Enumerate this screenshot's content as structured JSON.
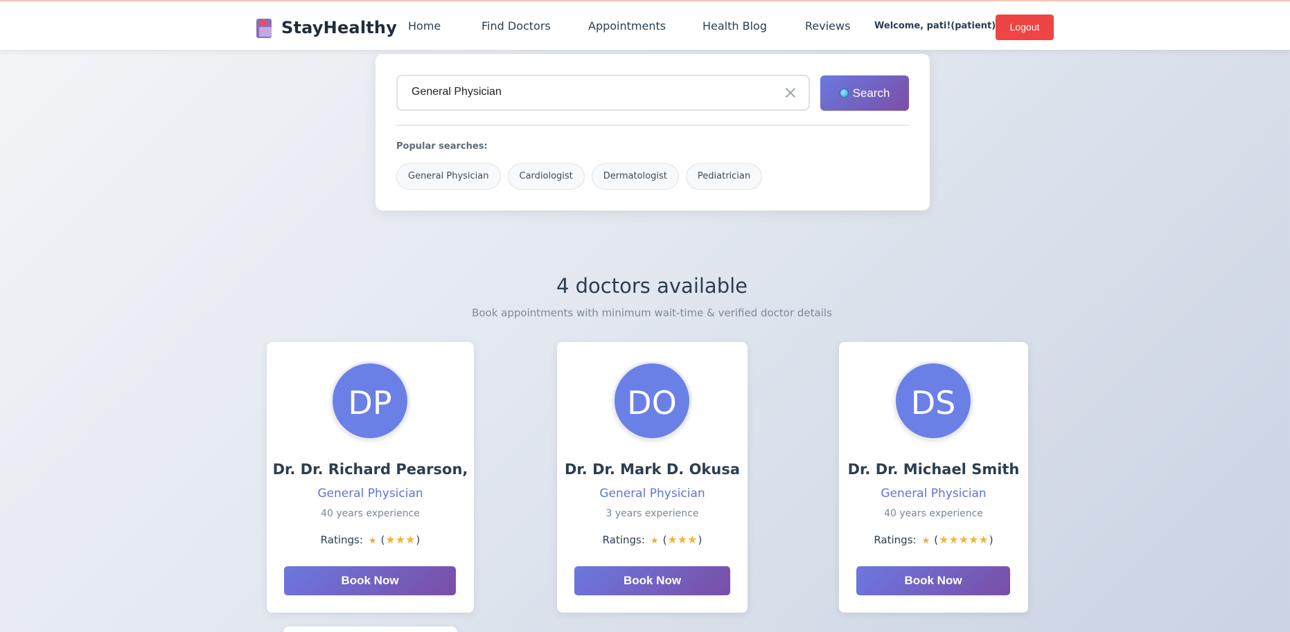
{
  "nav": {
    "brand": "StayHealthy",
    "links": [
      "Home",
      "Find Doctors",
      "Appointments",
      "Health Blog",
      "Reviews"
    ],
    "welcome": "Welcome, pati!(patient)",
    "logout": "Logout"
  },
  "search": {
    "value": "General Physician",
    "button_label": "Search",
    "popular_label": "Popular searches:",
    "chips": [
      "General Physician",
      "Cardiologist",
      "Dermatologist",
      "Pediatrician"
    ]
  },
  "results": {
    "title": "4 doctors available",
    "subtitle": "Book appointments with minimum wait-time & verified doctor details"
  },
  "doctors": [
    {
      "initials": "DP",
      "name": "Dr. Dr. Richard Pearson,",
      "specialty": "General Physician",
      "experience": "40 years experience",
      "ratings_label": "Ratings:",
      "stars": "★★★",
      "book_label": "Book Now"
    },
    {
      "initials": "DO",
      "name": "Dr. Dr. Mark D. Okusa",
      "specialty": "General Physician",
      "experience": "3 years experience",
      "ratings_label": "Ratings:",
      "stars": "★★★",
      "book_label": "Book Now"
    },
    {
      "initials": "DS",
      "name": "Dr. Dr. Michael Smith",
      "specialty": "General Physician",
      "experience": "40 years experience",
      "ratings_label": "Ratings:",
      "stars": "★★★★★",
      "book_label": "Book Now"
    }
  ],
  "colors": {
    "accent": "#5b74e0",
    "logout": "#ef4444",
    "avatar": "#6b80e6"
  }
}
